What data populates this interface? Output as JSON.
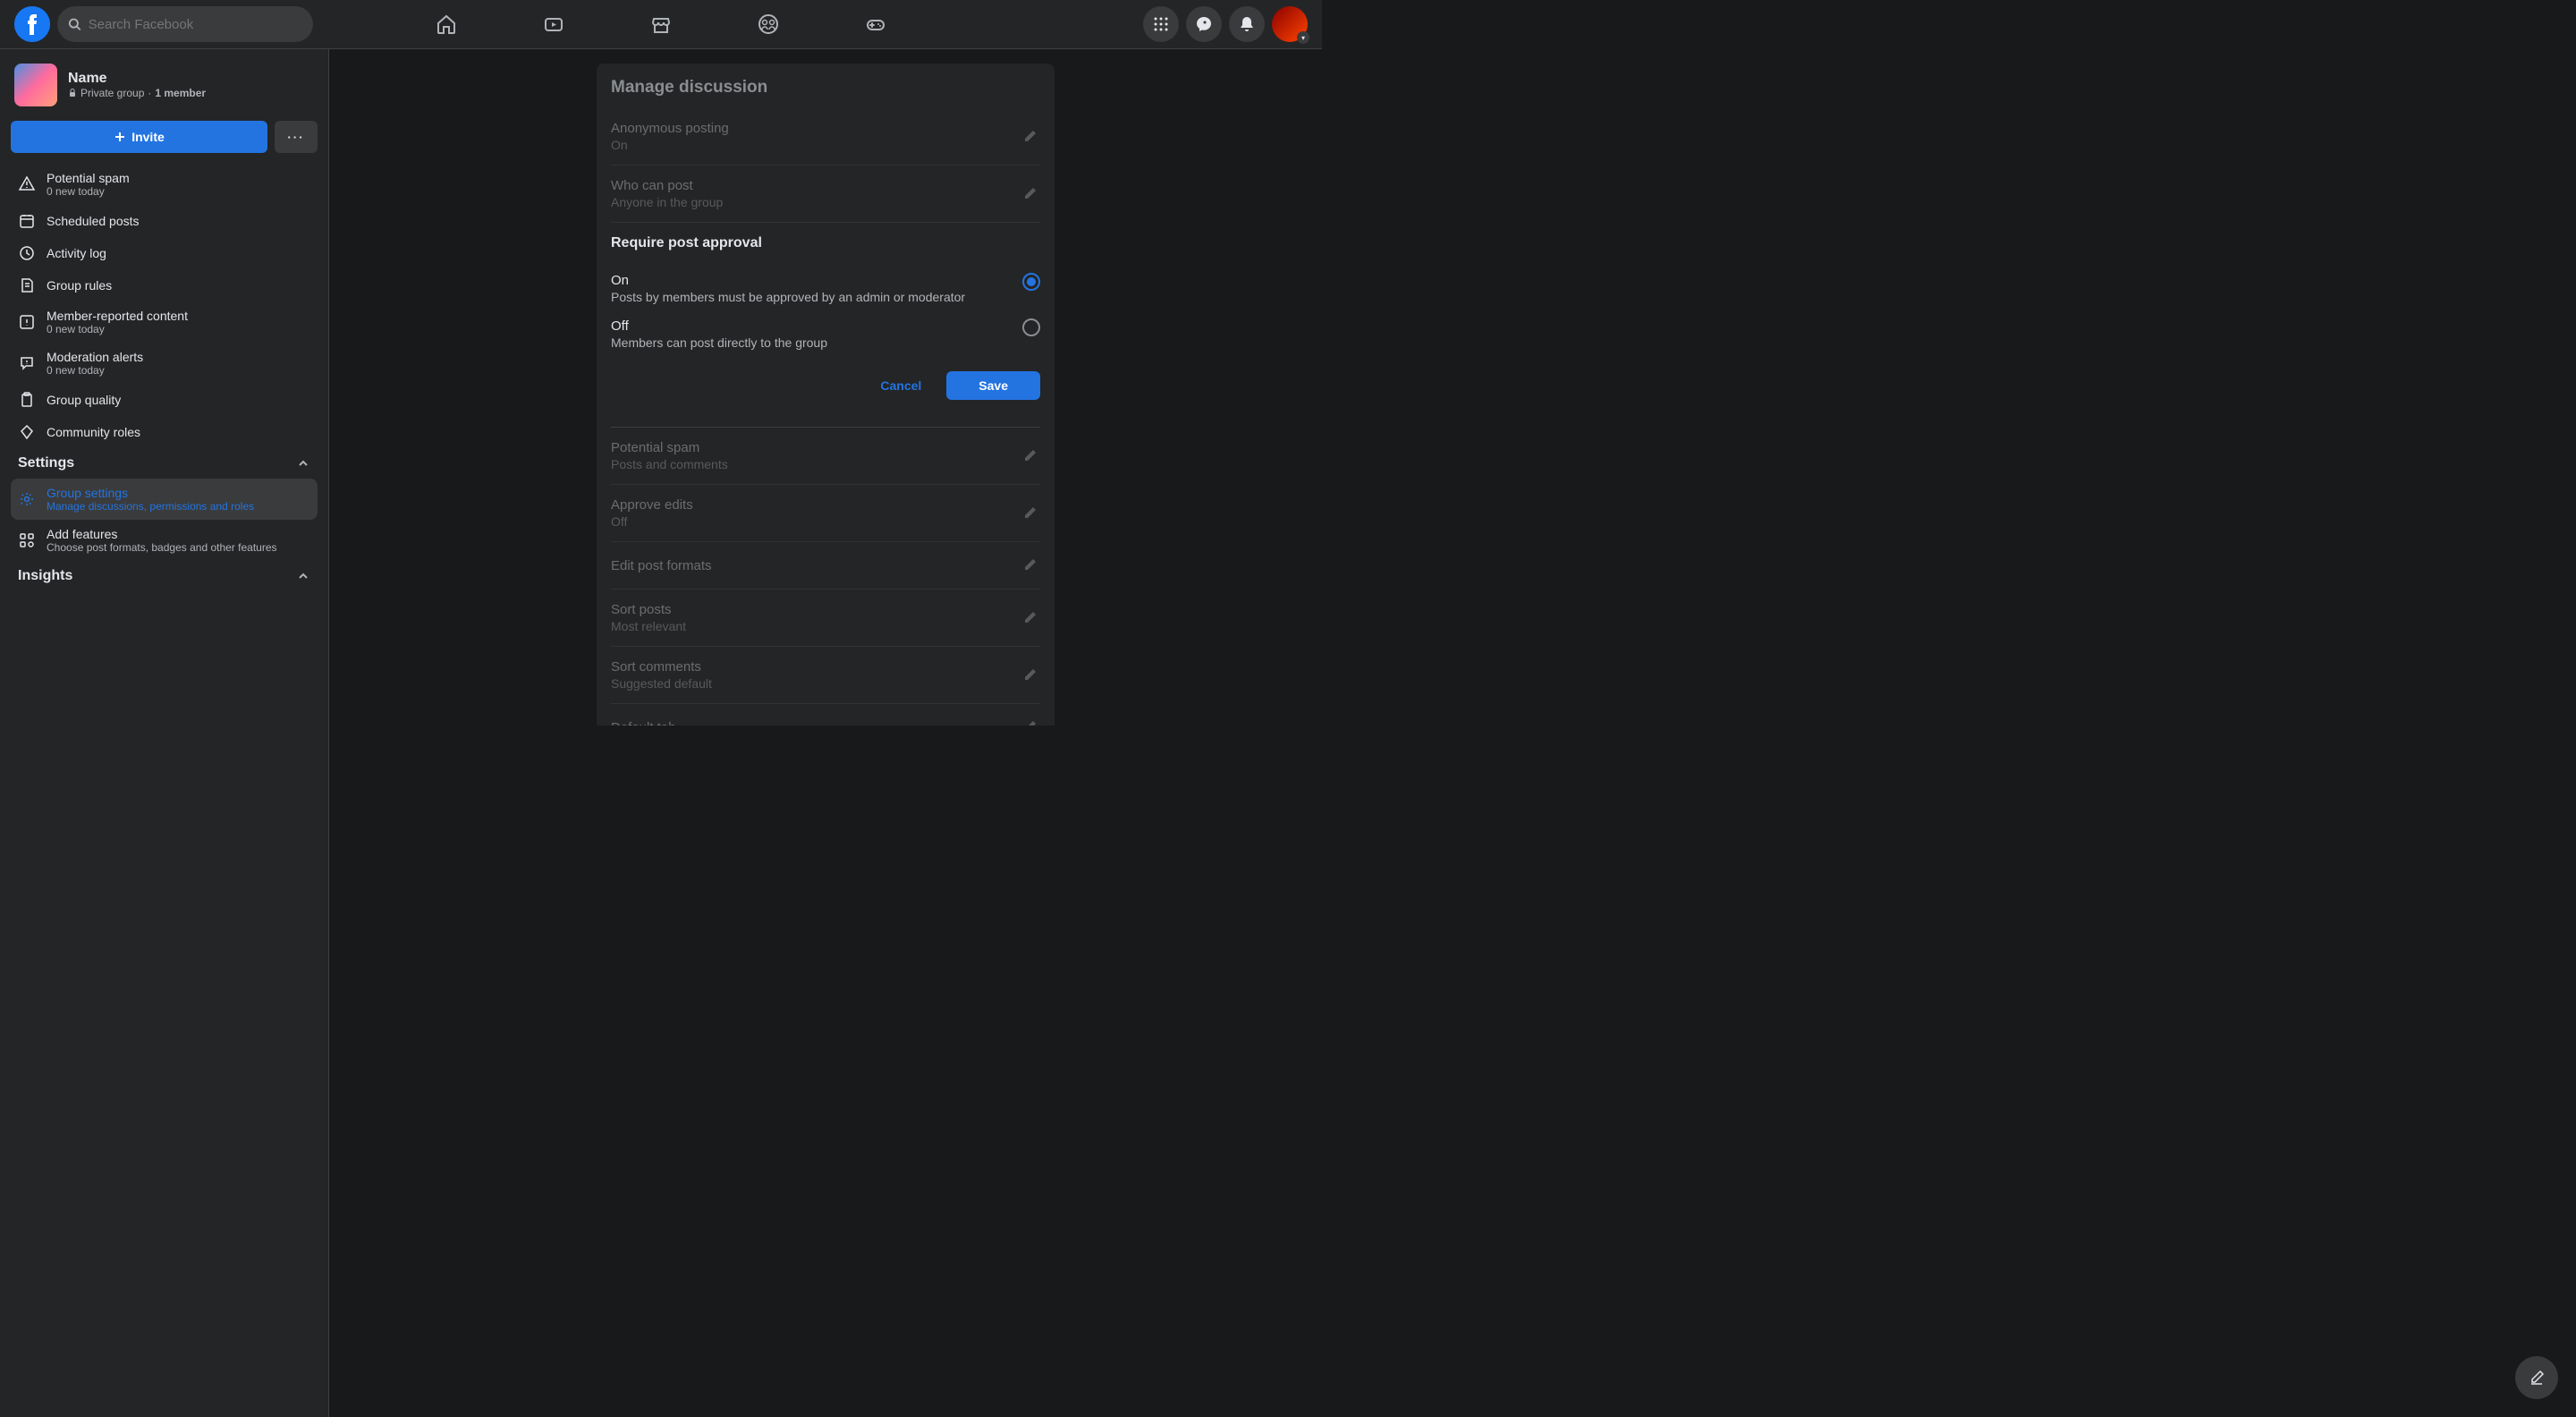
{
  "header": {
    "search_placeholder": "Search Facebook"
  },
  "sidebar": {
    "group_name": "Name",
    "group_privacy": "Private group",
    "group_members": "1 member",
    "invite_label": "Invite",
    "items": [
      {
        "label": "Potential spam",
        "sub": "0 new today"
      },
      {
        "label": "Scheduled posts",
        "sub": ""
      },
      {
        "label": "Activity log",
        "sub": ""
      },
      {
        "label": "Group rules",
        "sub": ""
      },
      {
        "label": "Member-reported content",
        "sub": "0 new today"
      },
      {
        "label": "Moderation alerts",
        "sub": "0 new today"
      },
      {
        "label": "Group quality",
        "sub": ""
      },
      {
        "label": "Community roles",
        "sub": ""
      }
    ],
    "settings_header": "Settings",
    "settings_items": [
      {
        "label": "Group settings",
        "sub": "Manage discussions, permissions and roles"
      },
      {
        "label": "Add features",
        "sub": "Choose post formats, badges and other features"
      }
    ],
    "insights_header": "Insights"
  },
  "panel": {
    "title": "Manage discussion",
    "settings": [
      {
        "label": "Anonymous posting",
        "value": "On"
      },
      {
        "label": "Who can post",
        "value": "Anyone in the group"
      }
    ],
    "expanded": {
      "title": "Require post approval",
      "options": [
        {
          "label": "On",
          "desc": "Posts by members must be approved by an admin or moderator"
        },
        {
          "label": "Off",
          "desc": "Members can post directly to the group"
        }
      ],
      "cancel": "Cancel",
      "save": "Save"
    },
    "settings_after": [
      {
        "label": "Potential spam",
        "value": "Posts and comments"
      },
      {
        "label": "Approve edits",
        "value": "Off"
      },
      {
        "label": "Edit post formats",
        "value": ""
      },
      {
        "label": "Sort posts",
        "value": "Most relevant"
      },
      {
        "label": "Sort comments",
        "value": "Suggested default"
      },
      {
        "label": "Default tab",
        "value": ""
      }
    ]
  }
}
